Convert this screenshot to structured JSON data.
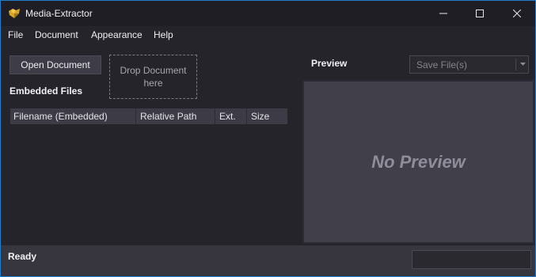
{
  "window": {
    "title": "Media-Extractor",
    "icon": "media-extractor-app-icon",
    "controls": [
      "minimize-icon",
      "maximize-icon",
      "close-icon"
    ]
  },
  "menu": {
    "items": [
      "File",
      "Document",
      "Appearance",
      "Help"
    ]
  },
  "left_panel": {
    "open_button": "Open Document",
    "drop_zone": "Drop Document here",
    "embedded_label": "Embedded Files",
    "table": {
      "columns": [
        "Filename (Embedded)",
        "Relative Path",
        "Ext.",
        "Size"
      ],
      "rows": []
    }
  },
  "right_panel": {
    "preview_label": "Preview",
    "save_select": {
      "selected": "Save File(s)",
      "options": []
    },
    "placeholder": "No Preview"
  },
  "status": {
    "text": "Ready"
  },
  "colors": {
    "window_border": "#1e7fd0",
    "background": "#25242b",
    "panel": "#403f4a",
    "accent_icon": "#d4a52a"
  }
}
